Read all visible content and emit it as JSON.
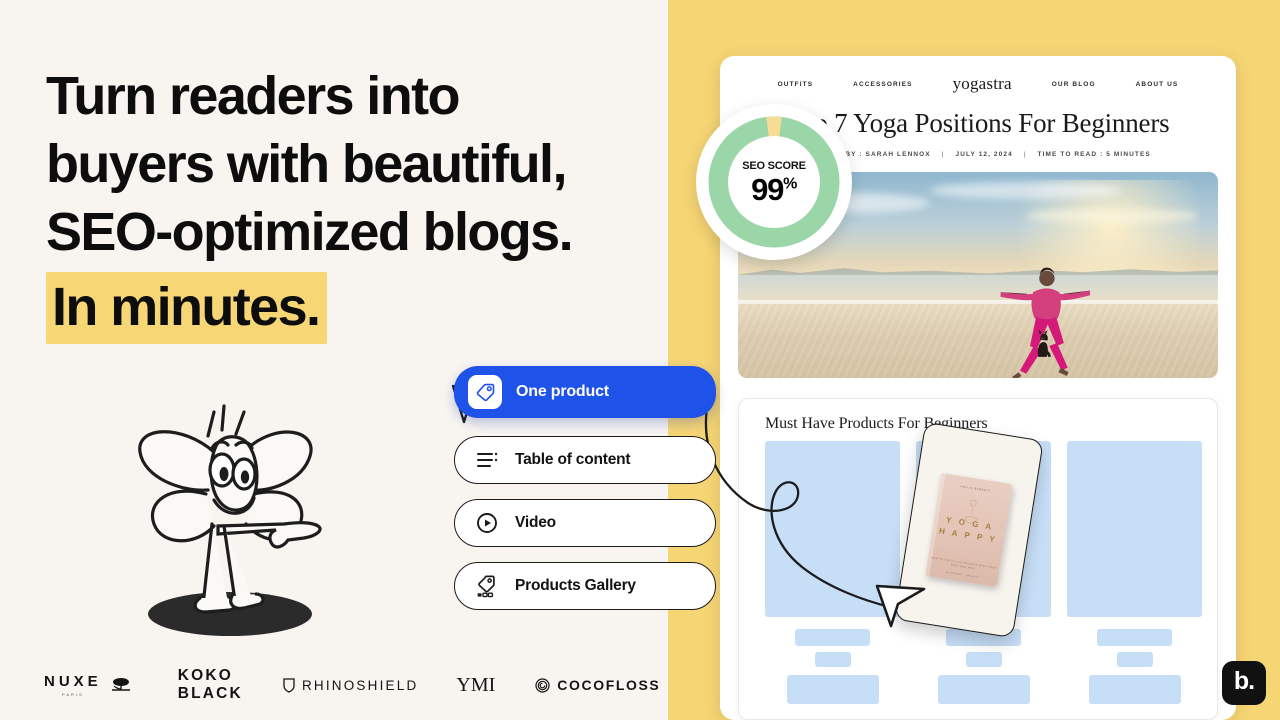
{
  "colors": {
    "left_bg": "#f8f5f1",
    "right_bg": "#f6d574",
    "highlight": "#f7d675",
    "accent_blue": "#1f52e8",
    "seo_green": "#9ad6a8",
    "placeholder_blue": "#c6def6",
    "logo_black": "#111111"
  },
  "hero": {
    "headline_line1": "Turn readers into",
    "headline_line2": "buyers with beautiful,",
    "headline_line3": "SEO-optimized blogs.",
    "headline_highlight": "In minutes."
  },
  "mascot": {
    "name": "butterfly-mascot-pointing-right"
  },
  "brands": [
    {
      "name": "NUXE",
      "sub": "PARIS",
      "icon": "tree-icon"
    },
    {
      "name": "KOKO BLACK",
      "sub": "",
      "icon": ""
    },
    {
      "name": "RHINOSHIELD",
      "sub": "",
      "icon": "shield-icon"
    },
    {
      "name": "YMI",
      "sub": "",
      "icon": ""
    },
    {
      "name": "COCOFLOSS",
      "sub": "",
      "icon": "spiral-icon"
    }
  ],
  "pills": [
    {
      "label": "One product",
      "icon": "tag-icon",
      "active": true
    },
    {
      "label": "Table of content",
      "icon": "list-icon",
      "active": false
    },
    {
      "label": "Video",
      "icon": "play-circle-icon",
      "active": false
    },
    {
      "label": "Products Gallery",
      "icon": "tag-gallery-icon",
      "active": false
    }
  ],
  "seo_badge": {
    "label": "SEO SCORE",
    "value": "99",
    "unit": "%",
    "score": 99
  },
  "blog": {
    "nav": [
      {
        "label": "OUTFITS"
      },
      {
        "label": "ACCESSORIES"
      },
      {
        "label": "OUR BLOG"
      },
      {
        "label": "ABOUT US"
      }
    ],
    "logo": "yogastra",
    "title": "Top 7 Yoga Positions For Beginners",
    "byline": {
      "author": "WRITTEN BY : SARAH LENNOX",
      "date": "JULY 12, 2024",
      "read_time": "TIME TO READ : 5 MINUTES",
      "separator": "|"
    },
    "hero_image_alt": "woman doing warrior yoga pose on a beach at sunset with a dog",
    "products_section": {
      "title": "Must Have Products For Beginners",
      "items": [
        {
          "placeholder": true
        },
        {
          "placeholder": true
        },
        {
          "placeholder": true
        }
      ]
    },
    "drag_card": {
      "book_author": "HOLLIE BARRETT",
      "book_title_line1": "Y O G A",
      "book_title_line2": "H A P P Y",
      "book_subtitle": "HOW TO FIND A LIFE BALANCE WITH YOUR BODY AND MIND",
      "book_footer": "MOVEMENT · BREATH"
    }
  },
  "watermark": {
    "label": "b."
  }
}
